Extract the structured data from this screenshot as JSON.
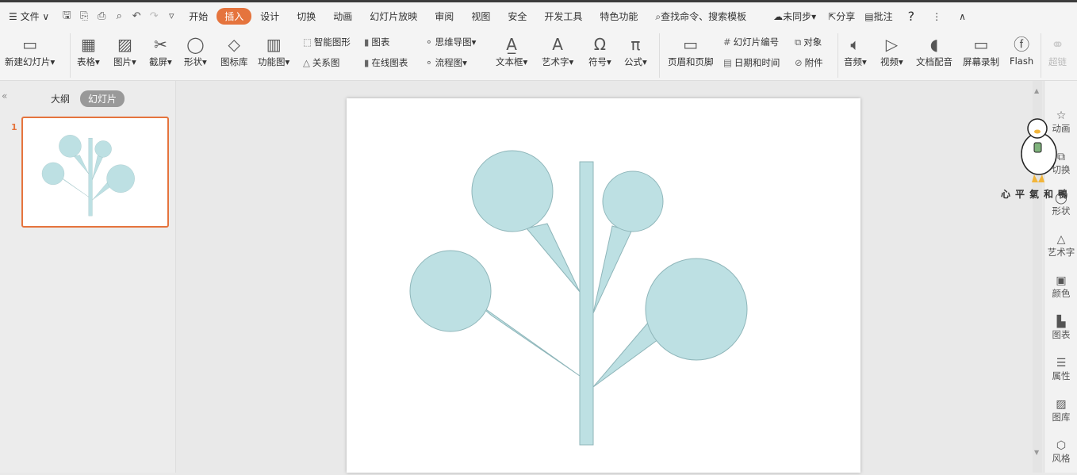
{
  "menu": {
    "file": "文件",
    "tabs": [
      "开始",
      "插入",
      "设计",
      "切换",
      "动画",
      "幻灯片放映",
      "审阅",
      "视图",
      "安全",
      "开发工具",
      "特色功能"
    ],
    "active_tab": "插入",
    "search": "查找命令、搜索模板",
    "sync": "未同步",
    "share": "分享",
    "comment": "批注",
    "help": "?"
  },
  "ribbon": {
    "new_slide": "新建幻灯片",
    "table": "表格",
    "picture": "图片",
    "screenshot": "截屏",
    "shape": "形状",
    "icon_lib": "图标库",
    "func_chart": "功能图",
    "smart_art": "智能图形",
    "relation": "关系图",
    "chart": "图表",
    "online_chart": "在线图表",
    "mind_map": "思维导图",
    "flowchart": "流程图",
    "textbox": "文本框",
    "wordart": "艺术字",
    "symbol": "符号",
    "formula": "公式",
    "header_footer": "页眉和页脚",
    "slide_number": "幻灯片编号",
    "datetime": "日期和时间",
    "object": "对象",
    "attachment": "附件",
    "audio": "音频",
    "video": "视频",
    "narration": "文档配音",
    "screen_record": "屏幕录制",
    "flash": "Flash",
    "hyperlink": "超链"
  },
  "left_panel": {
    "outline": "大纲",
    "slides": "幻灯片",
    "slide_number": "1"
  },
  "right_panel": {
    "items": [
      "动画",
      "切换",
      "形状",
      "艺术字",
      "颜色",
      "图表",
      "属性",
      "图库",
      "风格"
    ]
  },
  "sticker": {
    "caption": "心平氣和鴨"
  },
  "colors": {
    "accent": "#e5743d",
    "shape_fill": "#bde0e3",
    "shape_stroke": "#8fb6ba"
  }
}
